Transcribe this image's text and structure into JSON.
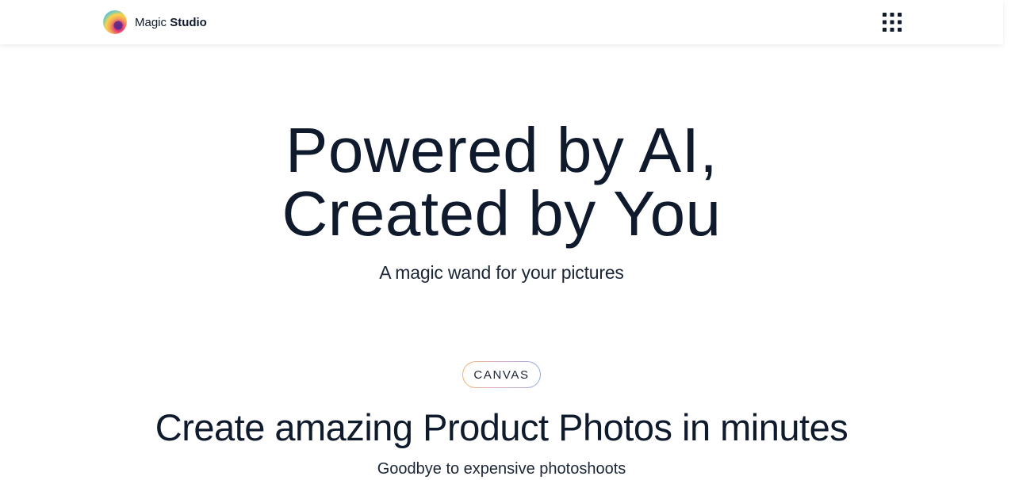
{
  "header": {
    "brand": {
      "name_light": "Magic",
      "name_bold": "Studio",
      "logo_icon": "magic-studio-logo-icon"
    },
    "apps_icon": "grid-menu-icon"
  },
  "hero": {
    "title_line1": "Powered by AI,",
    "title_line2": "Created by You",
    "subtitle": "A magic wand for your pictures"
  },
  "feature": {
    "badge": "CANVAS",
    "title": "Create amazing Product Photos in minutes",
    "subtitle": "Goodbye to expensive photoshoots"
  },
  "colors": {
    "text": "#0f1b2d",
    "badge_gradient": [
      "#f2b46a",
      "#d9a6c8",
      "#8ea6e6"
    ],
    "logo_gradient": [
      "#3fc3e8",
      "#f9d34b",
      "#f06a8a",
      "#5b2a86"
    ]
  }
}
